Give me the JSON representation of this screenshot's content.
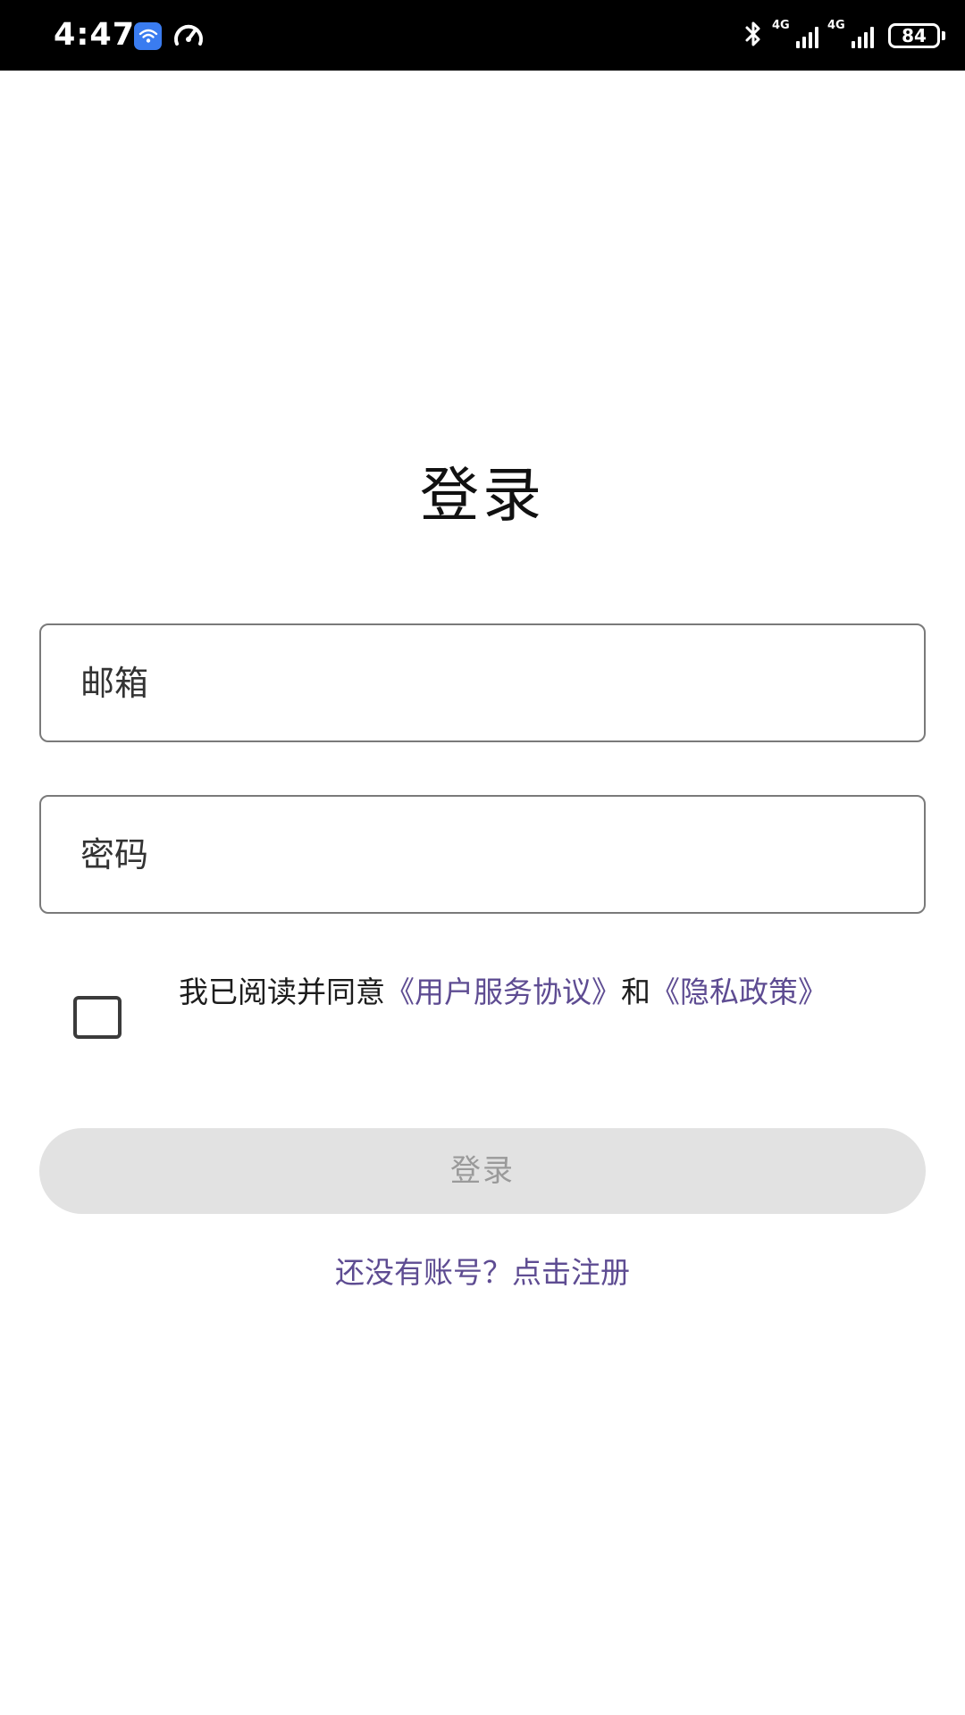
{
  "status_bar": {
    "time": "4:47",
    "network_type_1": "4G",
    "network_type_2": "4G",
    "battery_level": "84",
    "colors": {
      "background": "#000000",
      "foreground": "#ffffff",
      "app_icon": "#3a7cf0"
    },
    "icons": [
      "wifi-app-icon",
      "speedometer-icon",
      "bluetooth-icon",
      "signal-icon",
      "signal-icon",
      "battery-icon"
    ]
  },
  "login": {
    "title": "登录",
    "email_placeholder": "邮箱",
    "password_placeholder": "密码",
    "agreement": {
      "checked": false,
      "prefix": "我已阅读并同意",
      "service_link": "《用户服务协议》",
      "connector": "和",
      "privacy_link": "《隐私政策》"
    },
    "login_button": "登录",
    "register_link": "还没有账号？点击注册"
  },
  "colors": {
    "link": "#5e4c92",
    "button_disabled_bg": "#e2e2e2",
    "button_disabled_text": "#9a9a9a",
    "input_border": "#7a7a7a"
  }
}
